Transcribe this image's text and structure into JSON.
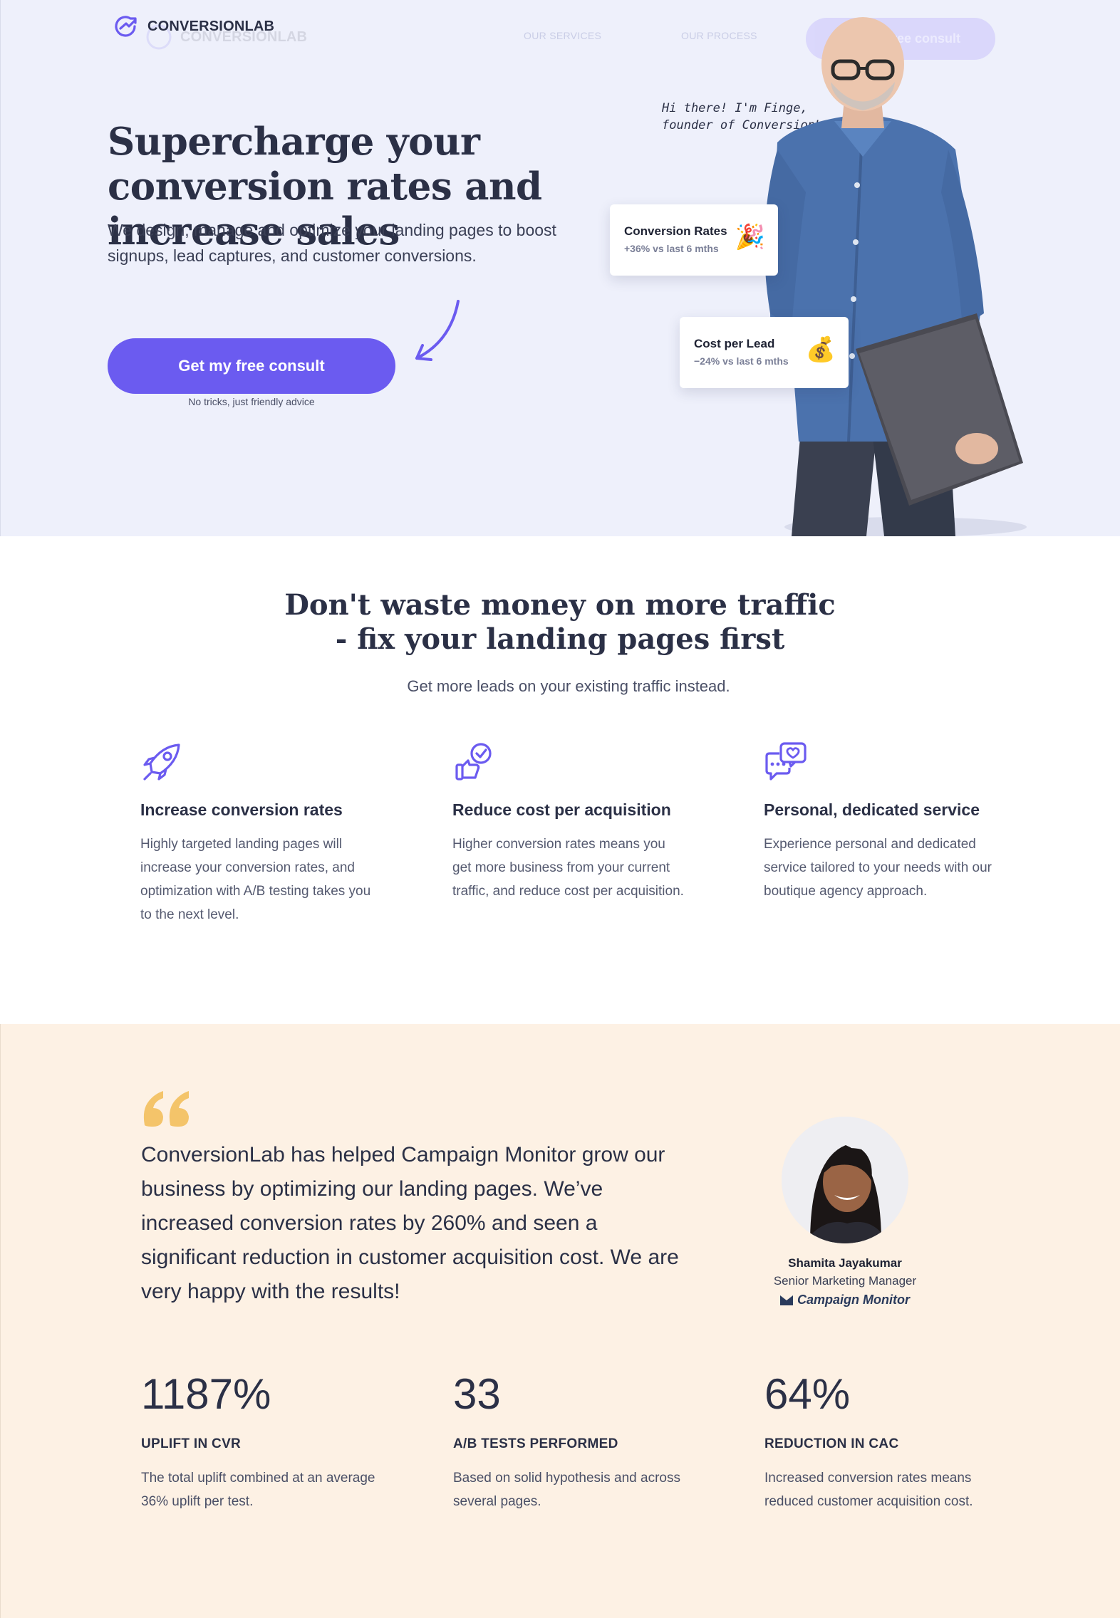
{
  "brand": {
    "name": "CONVERSIONLAB",
    "accent": "#6b5bf0",
    "hero_bg": "#eef0fb",
    "testimonial_bg": "#fdf1e4"
  },
  "nav": {
    "links": [
      "OUR SERVICES",
      "OUR PROCESS"
    ],
    "cta": "Get my free consult"
  },
  "hero": {
    "title": "Supercharge your conversion rates and increase sales",
    "subtitle": "We design, manage and optimize your landing pages to boost signups, lead captures, and customer conversions.",
    "cta": "Get my free consult",
    "cta_note": "No tricks, just friendly advice",
    "founder_note_line1": "Hi there! I'm Finge,",
    "founder_note_line2": "founder of ConversionLab",
    "cards": [
      {
        "title": "Conversion Rates",
        "stat": "+36% vs last 6 mths",
        "emoji": "🎉"
      },
      {
        "title": "Cost per Lead",
        "stat": "−24% vs last 6 mths",
        "emoji": "💰"
      }
    ]
  },
  "value": {
    "title_line1": "Don't waste money on more traffic",
    "title_line2": "- fix your landing pages first",
    "subtitle": "Get more leads on your existing traffic instead.",
    "features": [
      {
        "icon": "rocket-icon",
        "title": "Increase conversion rates",
        "text": "Highly targeted landing pages will increase your conversion rates, and optimization with A/B testing takes you to the next level."
      },
      {
        "icon": "thumbs-up-check-icon",
        "title": "Reduce cost per acquisition",
        "text": "Higher conversion rates means you get more business from your current traffic, and reduce cost per acquisition."
      },
      {
        "icon": "chat-heart-icon",
        "title": "Personal, dedicated service",
        "text": "Experience personal and dedicated service tailored to your needs with our boutique agency approach."
      }
    ]
  },
  "testimonial": {
    "quote": "ConversionLab has helped Campaign Monitor grow our business by optimizing our landing pages. We’ve increased conversion rates by 260% and seen a significant reduction in customer acquisition cost. We are very happy with the results!",
    "author": "Shamita Jayakumar",
    "role": "Senior Marketing Manager",
    "company": "Campaign Monitor",
    "quote_color": "#f4c46a"
  },
  "metrics": [
    {
      "value": "1187%",
      "label": "UPLIFT IN CVR",
      "desc": "The total uplift combined at an average 36% uplift per test."
    },
    {
      "value": "33",
      "label": "A/B TESTS PERFORMED",
      "desc": "Based on solid hypothesis and across several pages."
    },
    {
      "value": "64%",
      "label": "REDUCTION IN CAC",
      "desc": "Increased conversion rates means reduced customer acquisition cost."
    }
  ]
}
